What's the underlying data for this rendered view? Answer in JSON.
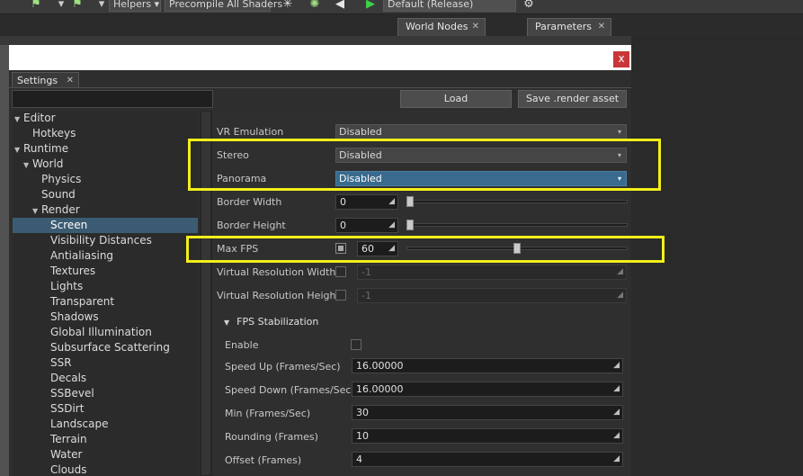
{
  "toolbar": {
    "helpers_label": "Helpers",
    "precompile_label": "Precompile All Shaders",
    "config_label": "Default (Release)"
  },
  "dock_tabs": [
    "World Nodes",
    "Parameters"
  ],
  "dialog": {
    "tab_label": "Settings",
    "close_glyph": "x",
    "load_label": "Load",
    "save_label": "Save .render asset"
  },
  "tree": [
    {
      "label": "Editor",
      "expanded": true,
      "depth": 0
    },
    {
      "label": "Hotkeys",
      "depth": 1
    },
    {
      "label": "Runtime",
      "expanded": true,
      "depth": 0
    },
    {
      "label": "World",
      "expanded": true,
      "depth": 1
    },
    {
      "label": "Physics",
      "depth": 2
    },
    {
      "label": "Sound",
      "depth": 2
    },
    {
      "label": "Render",
      "expanded": true,
      "depth": 2
    },
    {
      "label": "Screen",
      "depth": 3,
      "selected": true
    },
    {
      "label": "Visibility Distances",
      "depth": 3
    },
    {
      "label": "Antialiasing",
      "depth": 3
    },
    {
      "label": "Textures",
      "depth": 3
    },
    {
      "label": "Lights",
      "depth": 3
    },
    {
      "label": "Transparent",
      "depth": 3
    },
    {
      "label": "Shadows",
      "depth": 3
    },
    {
      "label": "Global Illumination",
      "depth": 3
    },
    {
      "label": "Subsurface Scattering",
      "depth": 3
    },
    {
      "label": "SSR",
      "depth": 3
    },
    {
      "label": "Decals",
      "depth": 3
    },
    {
      "label": "SSBevel",
      "depth": 3
    },
    {
      "label": "SSDirt",
      "depth": 3
    },
    {
      "label": "Landscape",
      "depth": 3
    },
    {
      "label": "Terrain",
      "depth": 3
    },
    {
      "label": "Water",
      "depth": 3
    },
    {
      "label": "Clouds",
      "depth": 3
    }
  ],
  "props": {
    "vr_emulation": {
      "label": "VR Emulation",
      "value": "Disabled"
    },
    "stereo": {
      "label": "Stereo",
      "value": "Disabled"
    },
    "panorama": {
      "label": "Panorama",
      "value": "Disabled"
    },
    "border_width": {
      "label": "Border Width",
      "value": "0",
      "slider": 0
    },
    "border_height": {
      "label": "Border Height",
      "value": "0",
      "slider": 0
    },
    "max_fps": {
      "label": "Max FPS",
      "value": "60",
      "checked": true,
      "slider": 0.5
    },
    "virtual_res_width": {
      "label": "Virtual Resolution Width",
      "value": "-1",
      "checked": false
    },
    "virtual_res_height": {
      "label": "Virtual Resolution Height",
      "value": "-1",
      "checked": false
    }
  },
  "fps_stabilization": {
    "title": "FPS Stabilization",
    "enable": {
      "label": "Enable",
      "checked": false
    },
    "speed_up": {
      "label": "Speed Up (Frames/Sec)",
      "value": "16.00000"
    },
    "speed_down": {
      "label": "Speed Down (Frames/Sec)",
      "value": "16.00000"
    },
    "min": {
      "label": "Min (Frames/Sec)",
      "value": "30"
    },
    "rounding": {
      "label": "Rounding (Frames)",
      "value": "10"
    },
    "offset": {
      "label": "Offset (Frames)",
      "value": "4"
    }
  },
  "icons": {
    "dropdown": "▾",
    "resize": "◢",
    "expanded_arrow": "▼"
  },
  "colors": {
    "highlight": "#f2ef1b",
    "selection": "#3b5b72",
    "active_combo": "#3a6b8e",
    "close": "#c8363a"
  }
}
